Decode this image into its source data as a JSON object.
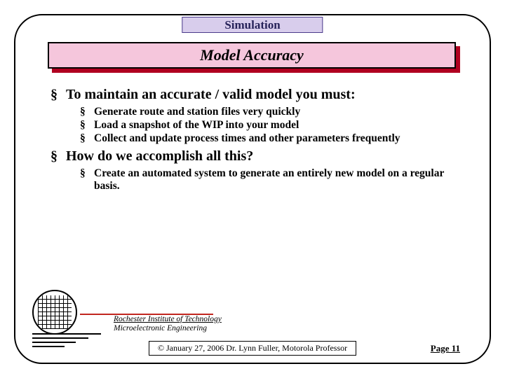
{
  "header": {
    "label": "Simulation"
  },
  "title": "Model Accuracy",
  "bullets": [
    {
      "text": "To maintain an accurate / valid model you must:",
      "children": [
        "Generate route and station files very quickly",
        "Load a snapshot of the WIP into your model",
        "Collect and update process times and other parameters frequently"
      ]
    },
    {
      "text": "How do we accomplish all this?",
      "children": [
        "Create an automated system to generate an entirely new model on a regular basis."
      ]
    }
  ],
  "affiliation": {
    "line1": "Rochester Institute of Technology",
    "line2": "Microelectronic Engineering"
  },
  "footer": {
    "copyright": "© January 27, 2006  Dr. Lynn Fuller, Motorola Professor",
    "page": "Page 11"
  },
  "glyph": {
    "bullet": "§"
  }
}
